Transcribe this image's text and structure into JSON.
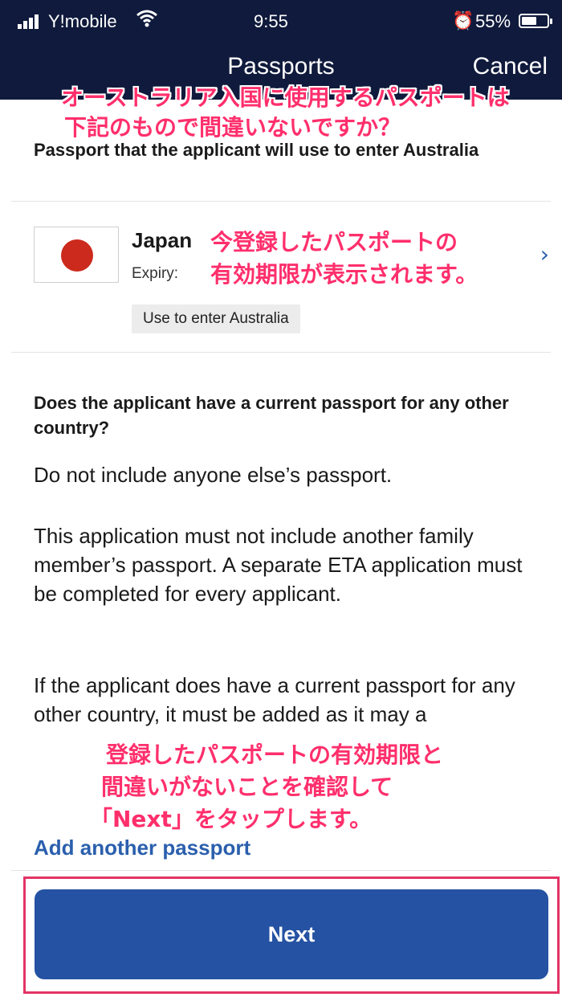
{
  "status_bar": {
    "carrier": "Y!mobile",
    "time": "9:55",
    "battery": "55%",
    "wifi_icon": "wifi-icon",
    "alarm_icon": "alarm-icon"
  },
  "nav": {
    "title": "Passports",
    "cancel": "Cancel"
  },
  "annotations": {
    "top_line1": "オーストラリア入国に使用するパスポートは",
    "top_line2": "下記のもので間違いないですか？",
    "passport_line1": "今登録したパスポートの",
    "passport_line2": "有効期限が表示されます。",
    "bottom_line1": "登録したパスポートの有効期限と",
    "bottom_line2": "間違いがないことを確認して",
    "bottom_line3": "「Next」をタップします。",
    "color": "#ff2f6c"
  },
  "intro": "Passport that the applicant will use to enter Australia",
  "passport": {
    "country": "Japan",
    "expiry_label": "Expiry:",
    "badge": "Use to enter Australia",
    "flag_icon": "japan-flag-icon",
    "chevron_icon": "chevron-right-icon"
  },
  "question": "Does the applicant have a current passport for any other country?",
  "paragraphs": {
    "p1": "Do not include anyone else’s passport.",
    "p2": "This application must not include another family member’s passport. A separate ETA application must be completed for every applicant.",
    "p3_visible": "If the applicant does have a current passport for any other country, it must be added as it may a"
  },
  "add_passport": "Add another passport",
  "next_button": "Next",
  "colors": {
    "nav_bg": "#0f1a3c",
    "link": "#2b5fad",
    "button": "#2552a3",
    "highlight_frame": "#e33466"
  }
}
